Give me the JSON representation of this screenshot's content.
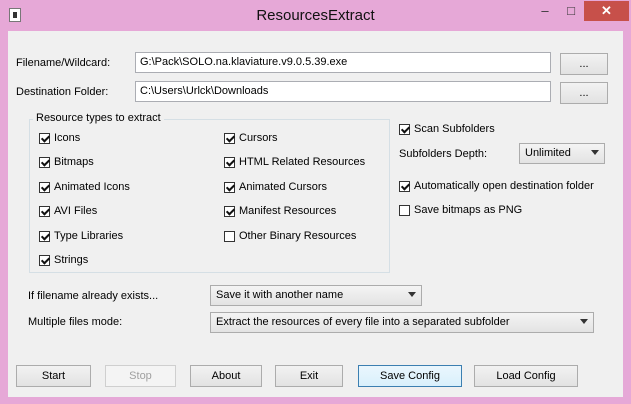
{
  "window": {
    "title": "ResourcesExtract",
    "min_glyph": "–",
    "max_glyph": "□",
    "close_glyph": "✕"
  },
  "filename": {
    "label": "Filename/Wildcard:",
    "value": "G:\\Pack\\SOLO.na.klaviature.v9.0.5.39.exe",
    "browse": "..."
  },
  "destination": {
    "label": "Destination Folder:",
    "value": "C:\\Users\\Urlck\\Downloads",
    "browse": "..."
  },
  "resource_types": {
    "title": "Resource types to extract",
    "left": [
      {
        "label": "Icons",
        "checked": true
      },
      {
        "label": "Bitmaps",
        "checked": true
      },
      {
        "label": "Animated Icons",
        "checked": true
      },
      {
        "label": "AVI Files",
        "checked": true
      },
      {
        "label": "Type Libraries",
        "checked": true
      },
      {
        "label": "Strings",
        "checked": true
      }
    ],
    "right": [
      {
        "label": "Cursors",
        "checked": true
      },
      {
        "label": "HTML Related Resources",
        "checked": true
      },
      {
        "label": "Animated Cursors",
        "checked": true
      },
      {
        "label": "Manifest Resources",
        "checked": true
      },
      {
        "label": "Other Binary Resources",
        "checked": false
      }
    ]
  },
  "options": {
    "scan_subfolders": {
      "label": "Scan Subfolders",
      "checked": true
    },
    "depth_label": "Subfolders Depth:",
    "depth_value": "Unlimited",
    "auto_open": {
      "label": "Automatically open destination folder",
      "checked": true
    },
    "save_png": {
      "label": "Save bitmaps as PNG",
      "checked": false
    }
  },
  "exists": {
    "label": "If filename already exists...",
    "value": "Save it with another name"
  },
  "multi": {
    "label": "Multiple files mode:",
    "value": "Extract the resources of every file into a separated subfolder"
  },
  "buttons": {
    "start": "Start",
    "stop": "Stop",
    "about": "About",
    "exit": "Exit",
    "save_config": "Save Config",
    "load_config": "Load Config"
  }
}
